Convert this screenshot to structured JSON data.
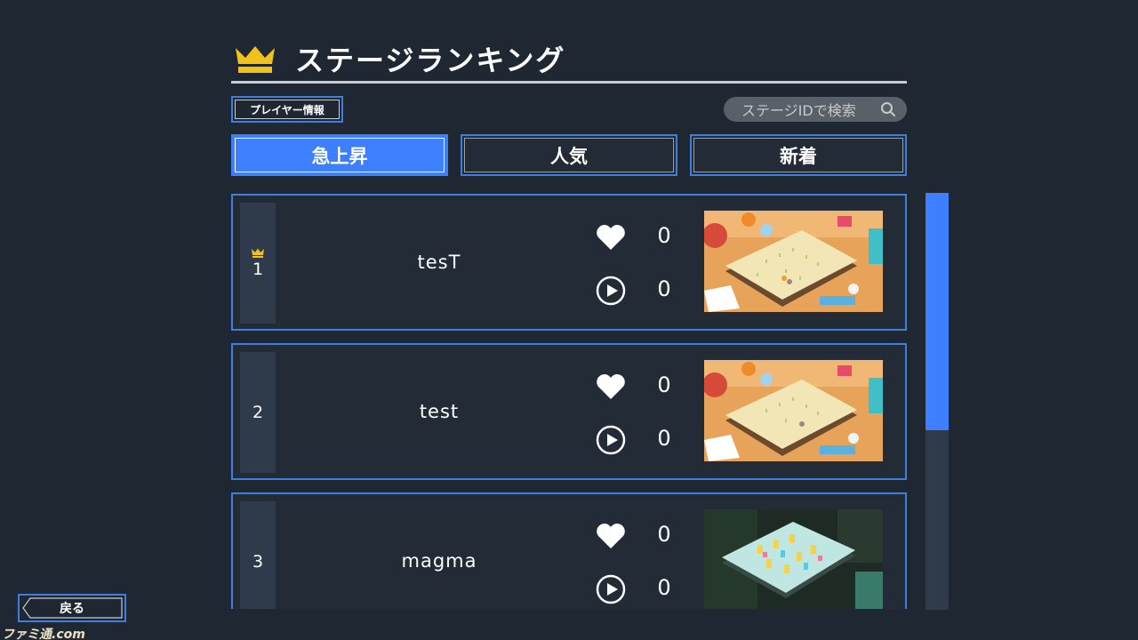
{
  "header": {
    "title": "ステージランキング",
    "icon": "crown-icon"
  },
  "player_info": {
    "label": "プレイヤー情報"
  },
  "search": {
    "placeholder": "ステージIDで検索",
    "icon": "search-icon"
  },
  "tabs": [
    {
      "label": "急上昇",
      "active": true
    },
    {
      "label": "人気",
      "active": false
    },
    {
      "label": "新着",
      "active": false
    }
  ],
  "stages": [
    {
      "rank": "1",
      "name": "tesT",
      "likes": "0",
      "plays": "0",
      "thumbnail": "toy-room-board",
      "top_crown": true
    },
    {
      "rank": "2",
      "name": "test",
      "likes": "0",
      "plays": "0",
      "thumbnail": "toy-room-board",
      "top_crown": false
    },
    {
      "rank": "3",
      "name": "magma",
      "likes": "0",
      "plays": "0",
      "thumbnail": "dark-room-board",
      "top_crown": false
    }
  ],
  "scroll": {
    "position_fraction": 0.0,
    "visible_fraction": 0.57
  },
  "back": {
    "label": "戻る"
  },
  "watermark": {
    "text": "ファミ通.com"
  },
  "colors": {
    "accent": "#3d7fff",
    "background": "#1f2733",
    "crown": "#f2c21b"
  }
}
